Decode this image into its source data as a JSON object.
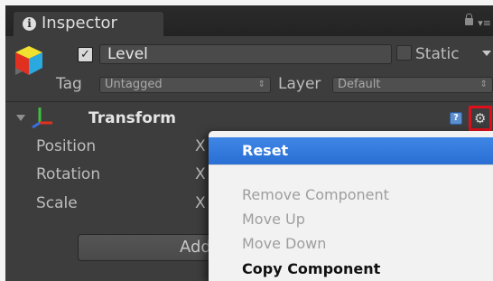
{
  "tab": {
    "title": "Inspector"
  },
  "object": {
    "name": "Level",
    "active_checked": true,
    "static_label": "Static",
    "static_checked": false
  },
  "tag": {
    "label": "Tag",
    "value": "Untagged"
  },
  "layer": {
    "label": "Layer",
    "value": "Default"
  },
  "component": {
    "title": "Transform"
  },
  "properties": [
    {
      "label": "Position",
      "axis": "X"
    },
    {
      "label": "Rotation",
      "axis": "X"
    },
    {
      "label": "Scale",
      "axis": "X"
    }
  ],
  "add_component": {
    "label": "Add"
  },
  "context_menu": {
    "items": [
      {
        "label": "Reset",
        "state": "highlighted"
      },
      {
        "label": "Remove Component",
        "state": "disabled"
      },
      {
        "label": "Move Up",
        "state": "disabled"
      },
      {
        "label": "Move Down",
        "state": "disabled"
      },
      {
        "label": "Copy Component",
        "state": "enabled"
      }
    ]
  },
  "icons": {
    "tab": "info-icon",
    "lock": "lock-icon",
    "menu": "panel-menu-icon",
    "object": "gameobject-cube-icon",
    "transform": "transform-axes-icon",
    "help": "help-book-icon",
    "settings": "gear-icon"
  },
  "colors": {
    "highlight": "#2f74d8",
    "gear_outline": "#e0101b",
    "panel": "#3d3d3d"
  }
}
